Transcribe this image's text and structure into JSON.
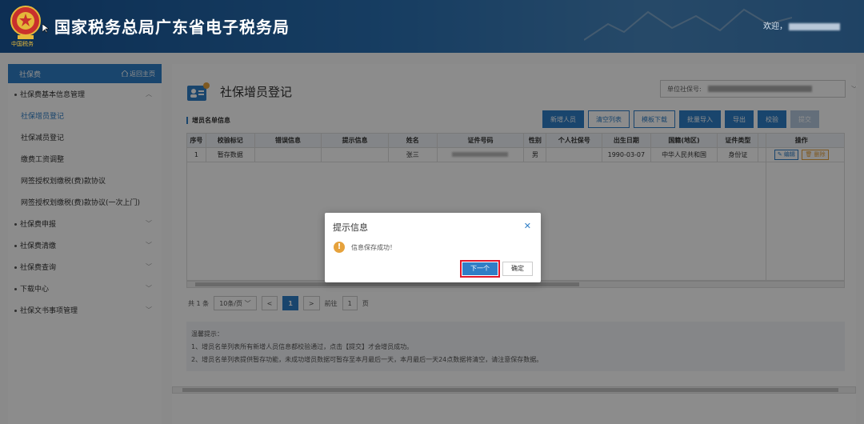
{
  "header": {
    "emblem_caption": "中国税务",
    "site_title": "国家税务总局广东省电子税务局",
    "welcome_text": "欢迎，"
  },
  "sidebar": {
    "title": "社保费",
    "home_label": "返回主页",
    "items": [
      {
        "label": "社保费基本信息管理",
        "type": "group"
      },
      {
        "label": "社保增员登记",
        "type": "sub",
        "active": true
      },
      {
        "label": "社保减员登记",
        "type": "sub"
      },
      {
        "label": "缴费工资调整",
        "type": "sub"
      },
      {
        "label": "网签授权划缴税(费)款协议",
        "type": "sub"
      },
      {
        "label": "网签授权划缴税(费)款协议(一次上门)",
        "type": "sub"
      },
      {
        "label": "社保费申报",
        "type": "group"
      },
      {
        "label": "社保费清缴",
        "type": "group"
      },
      {
        "label": "社保费查询",
        "type": "group"
      },
      {
        "label": "下载中心",
        "type": "group"
      },
      {
        "label": "社保文书事项管理",
        "type": "group"
      }
    ]
  },
  "main": {
    "page_title": "社保增员登记",
    "unit_label": "单位社保号:",
    "section_title": "增员名单信息",
    "toolbar": {
      "add": "新增人员",
      "clear": "清空列表",
      "template": "模板下载",
      "import": "批量导入",
      "export": "导出",
      "validate": "校验",
      "submit": "提交"
    },
    "table": {
      "headers": [
        "序号",
        "校验标记",
        "错误信息",
        "提示信息",
        "姓名",
        "证件号码",
        "性别",
        "个人社保号",
        "出生日期",
        "国籍(地区)",
        "证件类型",
        "操作"
      ],
      "rows": [
        {
          "no": "1",
          "flag": "暂存数据",
          "error": "",
          "hint": "",
          "name": "张三",
          "gender": "男",
          "ssn": "",
          "birth": "1990-03-07",
          "nation": "中华人民共和国",
          "id_type": "身份证",
          "edit": "编辑",
          "delete": "删除"
        }
      ]
    },
    "pager": {
      "total": "共 1 条",
      "page_size": "10条/页",
      "prev": "<",
      "current": "1",
      "next": ">",
      "goto": "前往",
      "goto_value": "1",
      "page_unit": "页"
    },
    "tips": {
      "title": "温馨提示：",
      "line1": "1、增员名单列表所有新增人员信息都校验通过，点击【提交】才会增员成功。",
      "line2": "2、增员名单列表提供暂存功能，未成功增员数据可暂存至本月最后一天，本月最后一天24点数据将清空，请注意保存数据。"
    }
  },
  "modal": {
    "title": "提示信息",
    "message": "信息保存成功！",
    "next_button": "下一个",
    "confirm_button": "确定",
    "highlight_color": "#e0192b"
  },
  "colors": {
    "primary": "#2f7ec6",
    "warning": "#e6a23c"
  }
}
